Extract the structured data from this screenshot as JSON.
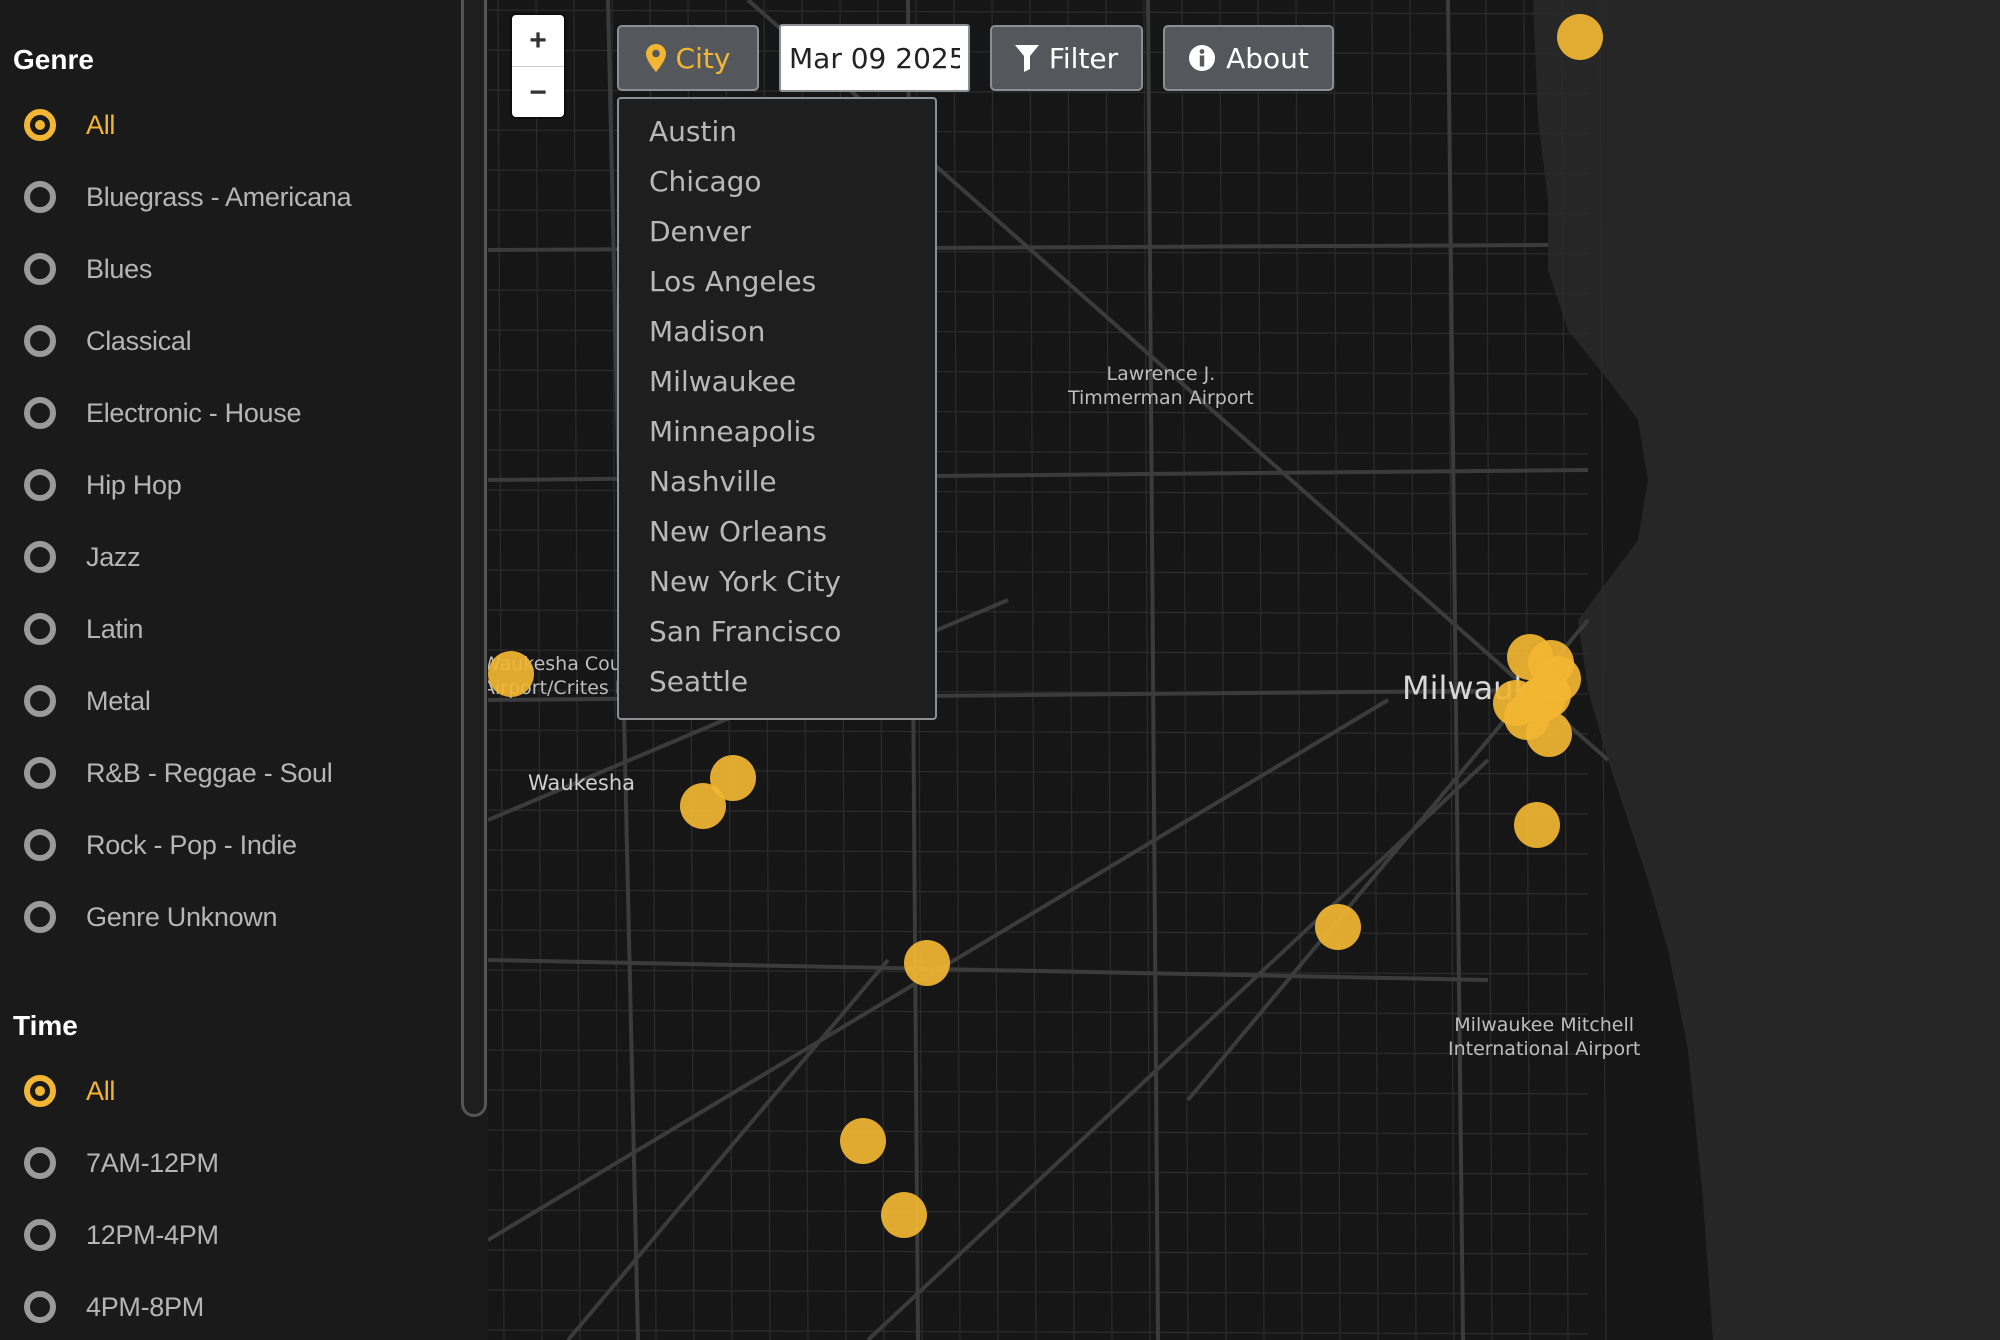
{
  "sidebar": {
    "genre_title": "Genre",
    "genres": [
      {
        "label": "All",
        "selected": true
      },
      {
        "label": "Bluegrass - Americana",
        "selected": false
      },
      {
        "label": "Blues",
        "selected": false
      },
      {
        "label": "Classical",
        "selected": false
      },
      {
        "label": "Electronic - House",
        "selected": false
      },
      {
        "label": "Hip Hop",
        "selected": false
      },
      {
        "label": "Jazz",
        "selected": false
      },
      {
        "label": "Latin",
        "selected": false
      },
      {
        "label": "Metal",
        "selected": false
      },
      {
        "label": "R&B - Reggae - Soul",
        "selected": false
      },
      {
        "label": "Rock - Pop - Indie",
        "selected": false
      },
      {
        "label": "Genre Unknown",
        "selected": false
      }
    ],
    "time_title": "Time",
    "times": [
      {
        "label": "All",
        "selected": true
      },
      {
        "label": "7AM-12PM",
        "selected": false
      },
      {
        "label": "12PM-4PM",
        "selected": false
      },
      {
        "label": "4PM-8PM",
        "selected": false
      }
    ]
  },
  "toolbar": {
    "zoom_in": "+",
    "zoom_out": "−",
    "city_label": "City",
    "date_value": "Mar 09 2025",
    "filter_label": "Filter",
    "about_label": "About"
  },
  "city_menu": [
    "Austin",
    "Chicago",
    "Denver",
    "Los Angeles",
    "Madison",
    "Milwaukee",
    "Minneapolis",
    "Nashville",
    "New Orleans",
    "New York City",
    "San Francisco",
    "Seattle"
  ],
  "map": {
    "labels": {
      "airport_timmerman": "Lawrence J.\nTimmerman Airport",
      "airport_mitchell": "Milwaukee Mitchell\nInternational Airport",
      "airport_waukesha": "Waukesha Cour\nAirport/Crites F",
      "city_waukesha": "Waukesha",
      "city_milwaukee": "Milwaukee"
    },
    "marker_count": 18
  },
  "colors": {
    "accent": "#f2b632",
    "sidebar_bg": "#1a1a1a",
    "map_bg": "#161616",
    "button_bg": "#54585d"
  }
}
